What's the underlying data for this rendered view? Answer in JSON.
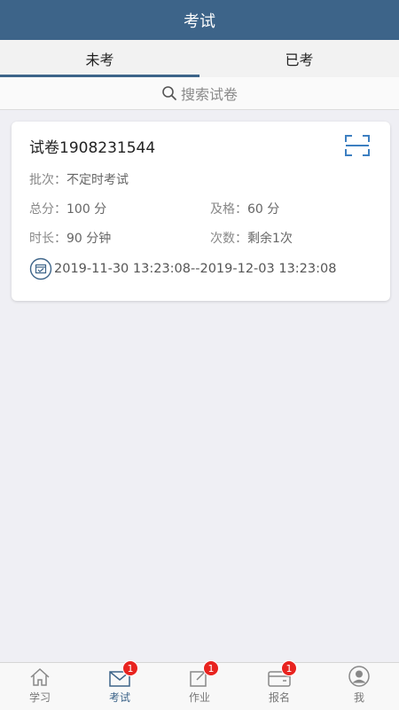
{
  "header": {
    "title": "考试"
  },
  "tabs": [
    {
      "label": "未考",
      "active": true
    },
    {
      "label": "已考",
      "active": false
    }
  ],
  "search": {
    "placeholder": "搜索试卷"
  },
  "exam_card": {
    "title": "试卷1908231544",
    "batch_label": "批次：",
    "batch_value": "不定时考试",
    "total_label": "总分：",
    "total_value": "100 分",
    "pass_label": "及格：",
    "pass_value": "60 分",
    "duration_label": "时长：",
    "duration_value": "90 分钟",
    "attempts_label": "次数：",
    "attempts_value": "剩余1次",
    "time_range": "2019-11-30 13:23:08--2019-12-03 13:23:08"
  },
  "bottom_nav": [
    {
      "label": "学习",
      "icon": "home-icon",
      "active": false,
      "badge": ""
    },
    {
      "label": "考试",
      "icon": "mail-icon",
      "active": true,
      "badge": "1"
    },
    {
      "label": "作业",
      "icon": "edit-icon",
      "active": false,
      "badge": "1"
    },
    {
      "label": "报名",
      "icon": "card-icon",
      "active": false,
      "badge": "1"
    },
    {
      "label": "我",
      "icon": "user-icon",
      "active": false,
      "badge": ""
    }
  ],
  "colors": {
    "primary": "#3d6489",
    "badge": "#e8231f",
    "background": "#efeff4"
  }
}
